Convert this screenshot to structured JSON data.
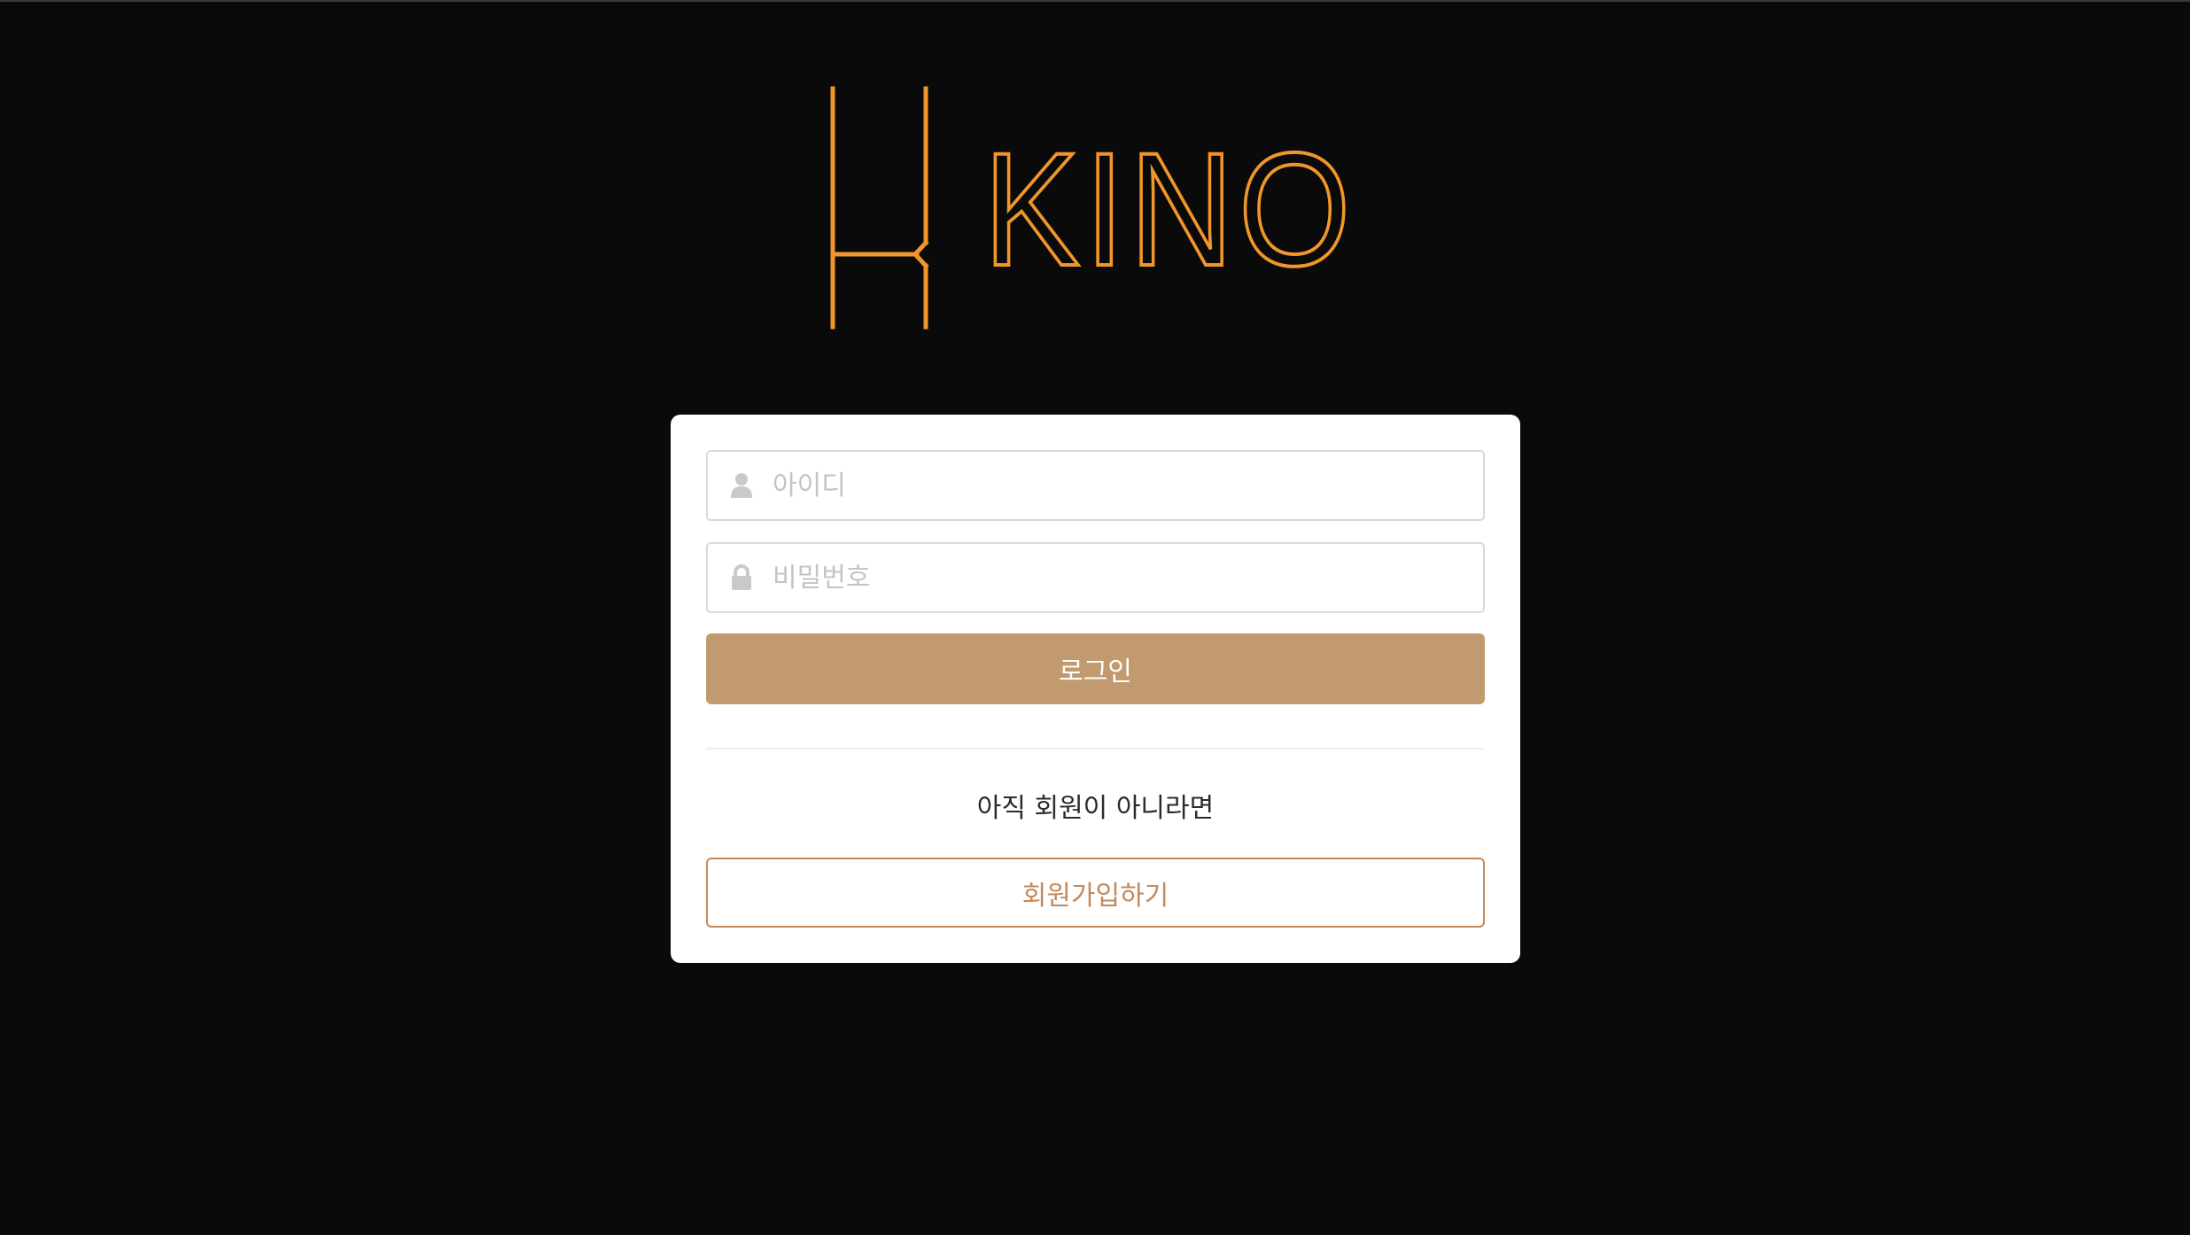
{
  "logo": {
    "text": "KINO",
    "color": "#f0962a"
  },
  "login_form": {
    "id_field": {
      "placeholder": "아이디",
      "value": "",
      "icon": "user-icon"
    },
    "password_field": {
      "placeholder": "비밀번호",
      "value": "",
      "icon": "lock-icon"
    },
    "login_button_label": "로그인",
    "signup_prompt": "아직 회원이 아니라면",
    "signup_button_label": "회원가입하기"
  },
  "colors": {
    "background": "#0a0a0a",
    "accent": "#f0962a",
    "login_button": "#c29a6f",
    "signup_border": "#c4895a",
    "placeholder": "#c4c4c4"
  }
}
